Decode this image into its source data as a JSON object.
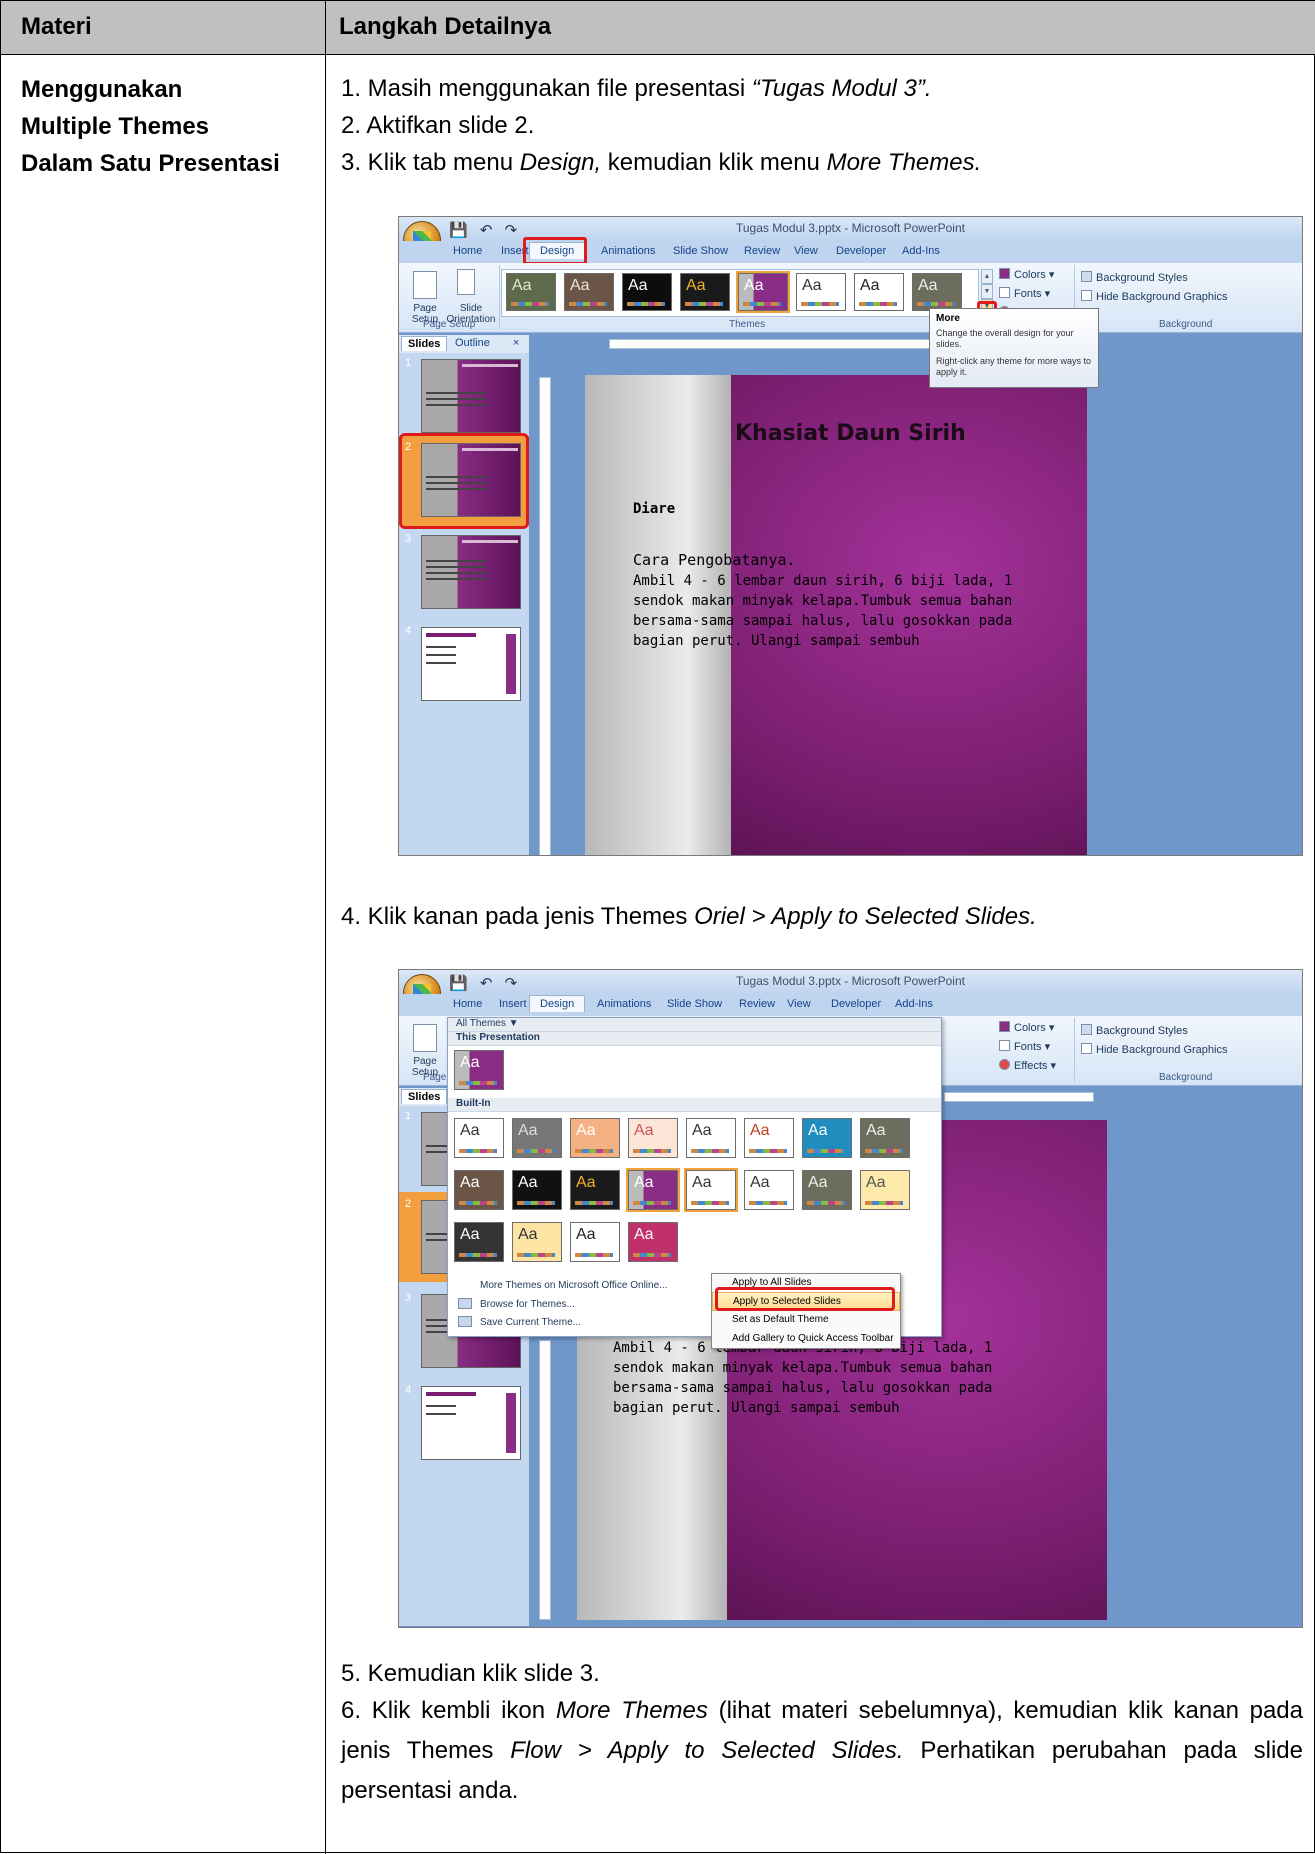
{
  "table": {
    "col1_header": "Materi",
    "col2_header": "Langkah Detailnya",
    "topic_lines": [
      "Menggunakan",
      "Multiple Themes",
      "Dalam Satu Presentasi"
    ]
  },
  "steps": {
    "s1_pre": "1. Masih menggunakan file presentasi ",
    "s1_file": "“Tugas Modul 3”.",
    "s2": "2. Aktifkan slide 2.",
    "s3_pre": "3. Klik tab menu ",
    "s3_design": "Design,",
    "s3_mid": " kemudian klik  menu ",
    "s3_more": "More Themes.",
    "s4_pre": "4. Klik kanan pada jenis Themes ",
    "s4_italic": "Oriel > Apply to Selected Slides.",
    "s5": "5. Kemudian klik slide 3.",
    "s6_pre": "6. Klik kembli ikon ",
    "s6_more": "More Themes",
    "s6_mid": " (lihat materi sebelumnya), kemudian klik kanan pada jenis Themes ",
    "s6_italic": "Flow > Apply to Selected Slides.",
    "s6_end": " Perhatikan perubahan pada slide persentasi anda."
  },
  "app": {
    "window_title": "Tugas Modul 3.pptx - Microsoft PowerPoint",
    "tabs": [
      "Home",
      "Insert",
      "Design",
      "Animations",
      "Slide Show",
      "Review",
      "View",
      "Developer",
      "Add-Ins"
    ],
    "active_tab": "Design",
    "page_setup_label": "Page Setup",
    "slide_orientation_label": "Slide Orientation",
    "page_label": "Page",
    "setup_label": "Setup",
    "slide_label": "Slide",
    "orientation_label": "Orientation",
    "themes_group": "Themes",
    "background_group": "Background",
    "colors": "Colors",
    "fonts": "Fonts",
    "effects": "Effects",
    "background_styles": "Background Styles",
    "hide_background": "Hide Background Graphics",
    "panel_tabs": [
      "Slides",
      "Outline"
    ],
    "theme_thumb_text": "Aa"
  },
  "tooltip": {
    "title": "More",
    "line1": "Change the overall design for your slides.",
    "line2": "Right-click any theme for more ways to apply it."
  },
  "slide": {
    "title": "Khasiat Daun Sirih",
    "subtitle": "Diare",
    "heading": "Cara Pengobatanya.",
    "body": "Ambil 4 - 6 lembar daun sirih, 6 biji lada, 1 sendok makan minyak kelapa.Tumbuk semua bahan bersama-sama sampai halus, lalu gosokkan pada bagian perut. Ulangi sampai sembuh"
  },
  "gallery": {
    "all_themes": "All Themes ▼",
    "this_presentation": "This Presentation",
    "built_in": "Built-In",
    "more_online": "More Themes on Microsoft Office Online...",
    "browse": "Browse for Themes...",
    "save": "Save Current Theme..."
  },
  "context_menu": {
    "items": [
      "Apply to All Slides",
      "Apply to Selected Slides",
      "Set as Default Theme",
      "Add Gallery to Quick Access Toolbar"
    ],
    "highlighted": "Apply to Selected Slides"
  },
  "colors": {
    "header_bg": "#c0c0c0",
    "highlight_red": "#e01a1a",
    "slide_purple": "#8a2d84",
    "ribbon_blue": "#6f97c9"
  }
}
